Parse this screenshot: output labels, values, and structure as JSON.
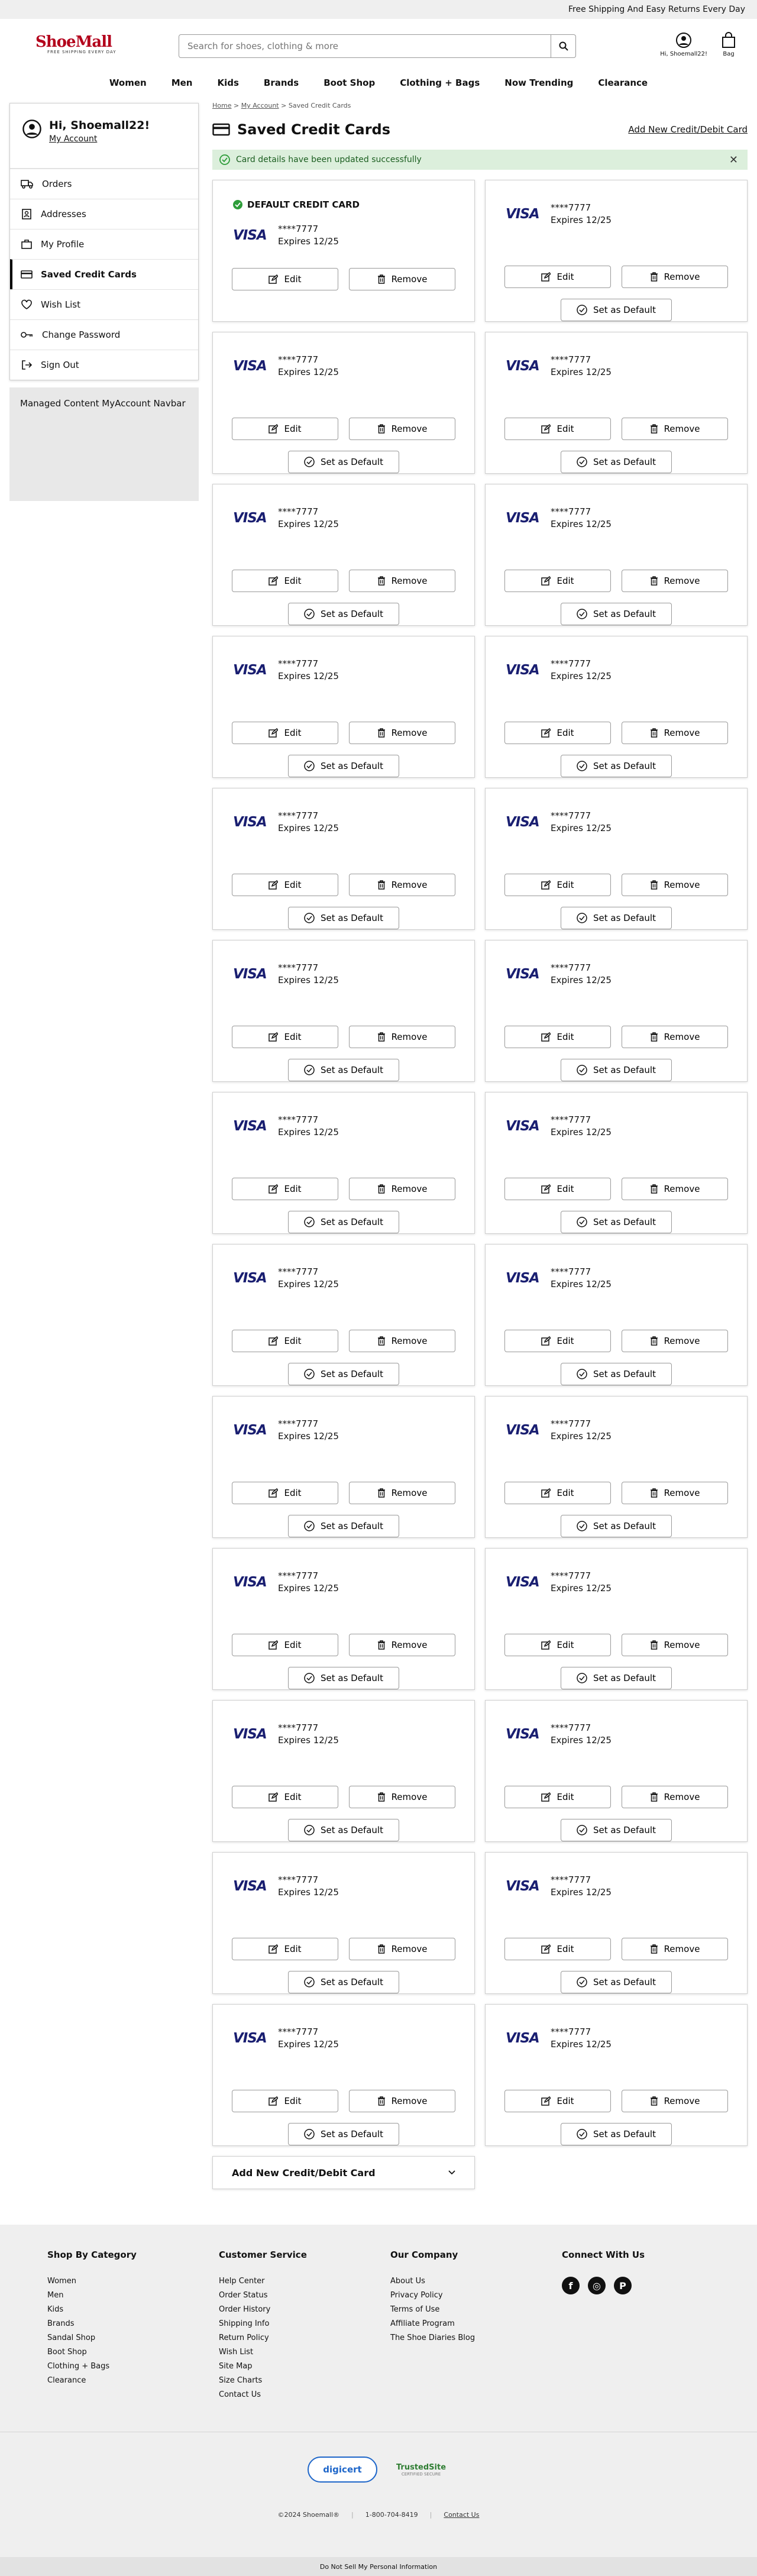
{
  "promo": "Free Shipping And Easy Returns Every Day",
  "logo": {
    "name": "ShoeMall",
    "tagline": "FREE SHIPPING EVERY DAY"
  },
  "search": {
    "placeholder": "Search for shoes, clothing & more"
  },
  "header": {
    "account_label": "Hi, Shoemall22!",
    "bag_label": "Bag"
  },
  "nav": [
    "Women",
    "Men",
    "Kids",
    "Brands",
    "Boot Shop",
    "Clothing + Bags",
    "Now Trending",
    "Clearance"
  ],
  "breadcrumb": {
    "home": "Home",
    "account": "My Account",
    "current": "Saved Credit Cards",
    "sep": ">"
  },
  "sidebar": {
    "greeting": "Hi, Shoemall22!",
    "account_link": "My Account",
    "items": [
      {
        "label": "Orders",
        "icon": "truck-icon"
      },
      {
        "label": "Addresses",
        "icon": "address-book-icon"
      },
      {
        "label": "My Profile",
        "icon": "briefcase-icon"
      },
      {
        "label": "Saved Credit Cards",
        "icon": "credit-card-icon",
        "active": true
      },
      {
        "label": "Wish List",
        "icon": "heart-icon"
      },
      {
        "label": "Change Password",
        "icon": "key-icon"
      },
      {
        "label": "Sign Out",
        "icon": "sign-out-icon"
      }
    ],
    "managed_content": "Managed Content MyAccount Navbar"
  },
  "main": {
    "title": "Saved Credit Cards",
    "add_link": "Add New Credit/Debit Card",
    "success_message": "Card details have been updated successfully",
    "default_label": "DEFAULT CREDIT CARD",
    "card_brand": "VISA",
    "card_number": "****7777",
    "card_expiry": "Expires 12/25",
    "edit_label": "Edit",
    "remove_label": "Remove",
    "set_default_label": "Set as Default",
    "card_count": 26,
    "add_collapse_label": "Add New Credit/Debit Card"
  },
  "footer": {
    "columns": [
      {
        "title": "Shop By Category",
        "links": [
          "Women",
          "Men",
          "Kids",
          "Brands",
          "Sandal Shop",
          "Boot Shop",
          "Clothing + Bags",
          "Clearance"
        ]
      },
      {
        "title": "Customer Service",
        "links": [
          "Help Center",
          "Order Status",
          "Order History",
          "Shipping Info",
          "Return Policy",
          "Wish List",
          "Site Map",
          "Size Charts",
          "Contact Us"
        ]
      },
      {
        "title": "Our Company",
        "links": [
          "About Us",
          "Privacy Policy",
          "Terms of Use",
          "Affiliate Program",
          "The Shoe Diaries Blog"
        ]
      },
      {
        "title": "Connect With Us",
        "links": []
      }
    ],
    "social": [
      "f",
      "◎",
      "P"
    ],
    "badges": {
      "digicert": "digicert",
      "trusted": "TrustedSite",
      "trusted_sub": "CERTIFIED SECURE"
    },
    "copyright": "©2024 Shoemall®",
    "phone": "1-800-704-8419",
    "contact": "Contact Us",
    "do_not_sell": "Do Not Sell My Personal Information"
  },
  "colors": {
    "brand": "#b3001b",
    "visa": "#1a1f71",
    "success_bg": "#dcefdc",
    "success_icon": "#2e9d3a"
  }
}
